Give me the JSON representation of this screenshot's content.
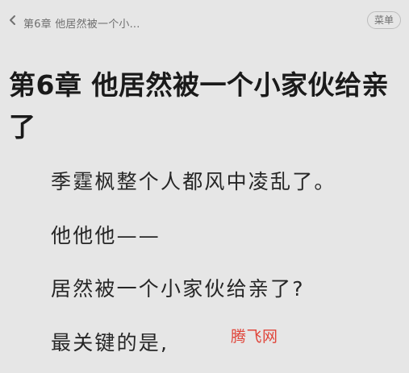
{
  "header": {
    "back_icon": "chevron-left-icon",
    "breadcrumb": "第6章 他居然被一个小...",
    "menu_label": "菜单"
  },
  "chapter": {
    "title": "第6章 他居然被一个小家伙给亲了"
  },
  "content": {
    "paragraphs": [
      "季霆枫整个人都风中凌乱了。",
      "他他他——",
      "居然被一个小家伙给亲了?",
      "最关键的是,"
    ]
  },
  "watermark": {
    "text": "腾飞网",
    "color": "#e0453a"
  }
}
